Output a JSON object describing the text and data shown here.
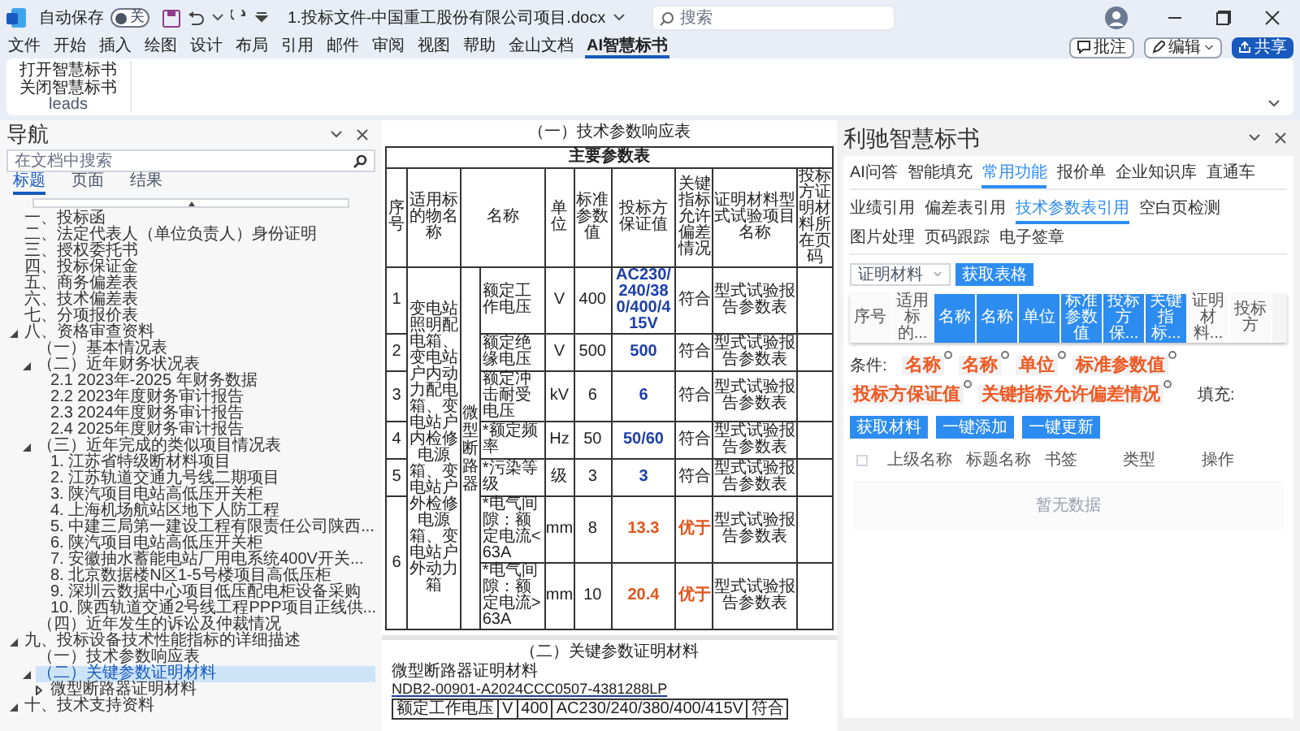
{
  "title_bar": {
    "autosave_label": "自动保存",
    "autosave": {
      "on": false,
      "label": "关"
    },
    "document_title": "1.投标文件-中国重工股份有限公司项目.docx",
    "search_placeholder": "搜索"
  },
  "ribbon": {
    "tabs": [
      {
        "label": "文件",
        "selected": false
      },
      {
        "label": "开始",
        "selected": false
      },
      {
        "label": "插入",
        "selected": false
      },
      {
        "label": "绘图",
        "selected": false
      },
      {
        "label": "设计",
        "selected": false
      },
      {
        "label": "布局",
        "selected": false
      },
      {
        "label": "引用",
        "selected": false
      },
      {
        "label": "邮件",
        "selected": false
      },
      {
        "label": "审阅",
        "selected": false
      },
      {
        "label": "视图",
        "selected": false
      },
      {
        "label": "帮助",
        "selected": false
      },
      {
        "label": "金山文档",
        "selected": false
      },
      {
        "label": "AI智慧标书",
        "selected": true
      }
    ],
    "comment_button": "批注",
    "editing_button": "编辑",
    "share_button": "共享",
    "commands": [
      "打开智慧标书",
      "关闭智慧标书"
    ],
    "group_label": "leads"
  },
  "navigation": {
    "title": "导航",
    "search_placeholder": "在文档中搜索",
    "tabs": [
      {
        "label": "标题",
        "selected": true
      },
      {
        "label": "页面",
        "selected": false
      },
      {
        "label": "结果",
        "selected": false
      }
    ],
    "items": [
      {
        "label": "一、投标函",
        "selected": false
      },
      {
        "label": "二、法定代表人（单位负责人）身份证明",
        "selected": false
      },
      {
        "label": "三、授权委托书",
        "selected": false
      },
      {
        "label": "四、投标保证金",
        "selected": false
      },
      {
        "label": "五、商务偏差表",
        "selected": false
      },
      {
        "label": "六、技术偏差表",
        "selected": false
      },
      {
        "label": "七、分项报价表",
        "selected": false
      },
      {
        "label": "八、资格审查资料",
        "selected": false,
        "expanded": true,
        "children": [
          {
            "label": "（一）基本情况表",
            "selected": false
          },
          {
            "label": "（二）近年财务状况表",
            "selected": false,
            "expanded": true,
            "children": [
              {
                "label": "2.1  2023年-2025 年财务数据",
                "selected": false
              },
              {
                "label": "2.2  2023年度财务审计报告",
                "selected": false
              },
              {
                "label": "2.3  2024年度财务审计报告",
                "selected": false
              },
              {
                "label": "2.4  2025年度财务审计报告",
                "selected": false
              }
            ]
          },
          {
            "label": "（三）近年完成的类似项目情况表",
            "selected": false,
            "expanded": true,
            "children": [
              {
                "label": "1. 江苏省特级断材料项目",
                "selected": false
              },
              {
                "label": "2. 江苏轨道交通九号线二期项目",
                "selected": false
              },
              {
                "label": "3. 陕汽项目电站高低压开关柜",
                "selected": false
              },
              {
                "label": "4. 上海机场航站区地下人防工程",
                "selected": false
              },
              {
                "label": "5. 中建三局第一建设工程有限责任公司陕西...",
                "selected": false
              },
              {
                "label": "6. 陕汽项目电站高低压开关柜",
                "selected": false
              },
              {
                "label": "7. 安徽抽水蓄能电站厂用电系统400V开关...",
                "selected": false
              },
              {
                "label": "8. 北京数据楼N区1-5号楼项目高低压柜",
                "selected": false
              },
              {
                "label": "9. 深圳云数据中心项目低压配电柜设备采购",
                "selected": false
              },
              {
                "label": "10. 陕西轨道交通2号线工程PPP项目正线供...",
                "selected": false
              }
            ]
          },
          {
            "label": "（四）近年发生的诉讼及仲裁情况",
            "selected": false
          }
        ]
      },
      {
        "label": "九、投标设备技术性能指标的详细描述",
        "selected": false,
        "expanded": true,
        "children": [
          {
            "label": "（一）技术参数响应表",
            "selected": false
          },
          {
            "label": "（二）关键参数证明材料",
            "selected": true,
            "expanded": true,
            "children": [
              {
                "label": "微型断路器证明材料",
                "selected": false,
                "expanded": false
              }
            ]
          }
        ]
      },
      {
        "label": "十、技术支持资料",
        "selected": false,
        "expanded": true
      }
    ]
  },
  "document": {
    "heading": "（一）技术参数响应表",
    "table": {
      "caption": "主要参数表",
      "columns": [
        "序号",
        "适用标的物名称",
        "名称",
        "单位",
        "标准参数值",
        "投标方保证值",
        "关键指标允许偏差情况",
        "证明材料型式试验项目名称",
        "投标方证明材料所在页码"
      ],
      "applies_to": "变电站照明配电箱、变电站户内动力配电箱、变电站户内检修电源箱、变电站户外检修电源箱、变电站户外动力箱",
      "product": "微型断路器",
      "rows": [
        {
          "no": "1",
          "name": "额定工作电压",
          "unit": "V",
          "standard": "400",
          "offered": "AC230/240/380/400/415V",
          "color": "#1d3fa8",
          "compliance": "符合",
          "evidence": "型式试验报告参数表"
        },
        {
          "no": "2",
          "name": "额定绝缘电压",
          "unit": "V",
          "standard": "500",
          "offered": "500",
          "color": "#1d3fa8",
          "compliance": "符合",
          "evidence": "型式试验报告参数表"
        },
        {
          "no": "3",
          "name": "额定冲击耐受电压",
          "unit": "kV",
          "standard": "6",
          "offered": "6",
          "color": "#1d3fa8",
          "compliance": "符合",
          "evidence": "型式试验报告参数表"
        },
        {
          "no": "4",
          "name": "*额定频率",
          "unit": "Hz",
          "standard": "50",
          "offered": "50/60",
          "color": "#1d3fa8",
          "compliance": "符合",
          "evidence": "型式试验报告参数表"
        },
        {
          "no": "5",
          "name": "*污染等级",
          "unit": "级",
          "standard": "3",
          "offered": "3",
          "color": "#1d3fa8",
          "compliance": "符合",
          "evidence": "型式试验报告参数表"
        },
        {
          "no": "6",
          "name": "*电气间隙：额定电流<63A",
          "unit": "mm",
          "standard": "8",
          "offered": "13.3",
          "color": "#e0561c",
          "compliance": "优于",
          "kind": "exceeds",
          "evidence": "型式试验报告参数表"
        },
        {
          "name": "*电气间隙：额定电流>63A",
          "unit": "mm",
          "standard": "10",
          "offered": "20.4",
          "color": "#e0561c",
          "compliance": "优于",
          "kind": "exceeds",
          "evidence": "型式试验报告参数表"
        }
      ]
    },
    "second_heading": "（二）关键参数证明材料",
    "subheading": "微型断路器证明材料",
    "reference": "NDB2-00901-A2024CCC0507-4381288LP",
    "evidence_rows": [
      [
        "额定工作电压",
        "V",
        "400",
        "AC230/240/380/400/415V",
        "符合"
      ]
    ]
  },
  "panel": {
    "title": "利驰智慧标书",
    "tabs": [
      {
        "label": "AI问答",
        "selected": false
      },
      {
        "label": "智能填充",
        "selected": false
      },
      {
        "label": "常用功能",
        "selected": true
      },
      {
        "label": "报价单",
        "selected": false
      },
      {
        "label": "企业知识库",
        "selected": false
      },
      {
        "label": "直通车",
        "selected": false
      }
    ],
    "subtabs": [
      {
        "label": "业绩引用",
        "selected": false
      },
      {
        "label": "偏差表引用",
        "selected": false
      },
      {
        "label": "技术参数表引用",
        "selected": true
      },
      {
        "label": "空白页检测",
        "selected": false
      },
      {
        "label": "图片处理",
        "selected": false
      },
      {
        "label": "页码跟踪",
        "selected": false
      },
      {
        "label": "电子签章",
        "selected": false
      }
    ],
    "source": "证明材料",
    "fetch_table": "获取表格",
    "columns": [
      {
        "label": "序号",
        "selected": false
      },
      {
        "label": "适用标的...",
        "selected": false
      },
      {
        "label": "名称",
        "selected": true
      },
      {
        "label": "名称",
        "selected": true
      },
      {
        "label": "单位",
        "selected": true
      },
      {
        "label": "标准参数值",
        "selected": true
      },
      {
        "label": "投标方保...",
        "selected": true
      },
      {
        "label": "关键指标...",
        "selected": true
      },
      {
        "label": "证明材料...",
        "selected": false
      },
      {
        "label": "投标方",
        "selected": false
      }
    ],
    "conditions_label": "条件:",
    "conditions": [
      "名称",
      "名称",
      "单位",
      "标准参数值",
      "投标方保证值",
      "关键指标允许偏差情况"
    ],
    "fill_label": "填充:",
    "buttons": [
      "获取材料",
      "一键添加",
      "一键更新"
    ],
    "results": {
      "checked": false,
      "columns": [
        "上级名称",
        "标题名称",
        "书签",
        "类型",
        "操作"
      ],
      "empty": "暂无数据"
    }
  }
}
